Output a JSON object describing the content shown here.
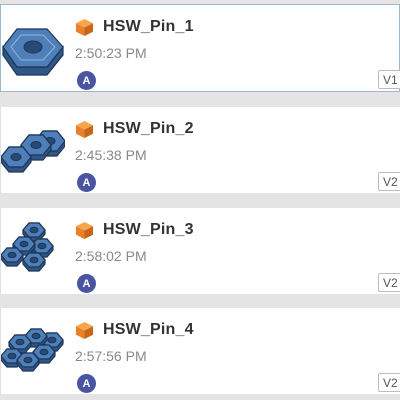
{
  "items": [
    {
      "title": "HSW_Pin_1",
      "time": "2:50:23 PM",
      "avatar": "A",
      "version": "V1",
      "part_icon": "orange-cube-icon",
      "thumbnail": "single-hex-pin"
    },
    {
      "title": "HSW_Pin_2",
      "time": "2:45:38 PM",
      "avatar": "A",
      "version": "V2",
      "part_icon": "orange-cube-icon",
      "thumbnail": "triple-hex-pin"
    },
    {
      "title": "HSW_Pin_3",
      "time": "2:58:02 PM",
      "avatar": "A",
      "version": "V2",
      "part_icon": "orange-cube-icon",
      "thumbnail": "cluster-hex-pin"
    },
    {
      "title": "HSW_Pin_4",
      "time": "2:57:56 PM",
      "avatar": "A",
      "version": "V2",
      "part_icon": "orange-cube-icon",
      "thumbnail": "cluster-hex-pin-large"
    }
  ],
  "colors": {
    "background": "#e4e4e4",
    "card": "#ffffff",
    "selected_border": "#9bb7d6",
    "avatar": "#4a55a2",
    "part_icon": "#f08a24",
    "thumbnail": "#4f7fb8"
  }
}
